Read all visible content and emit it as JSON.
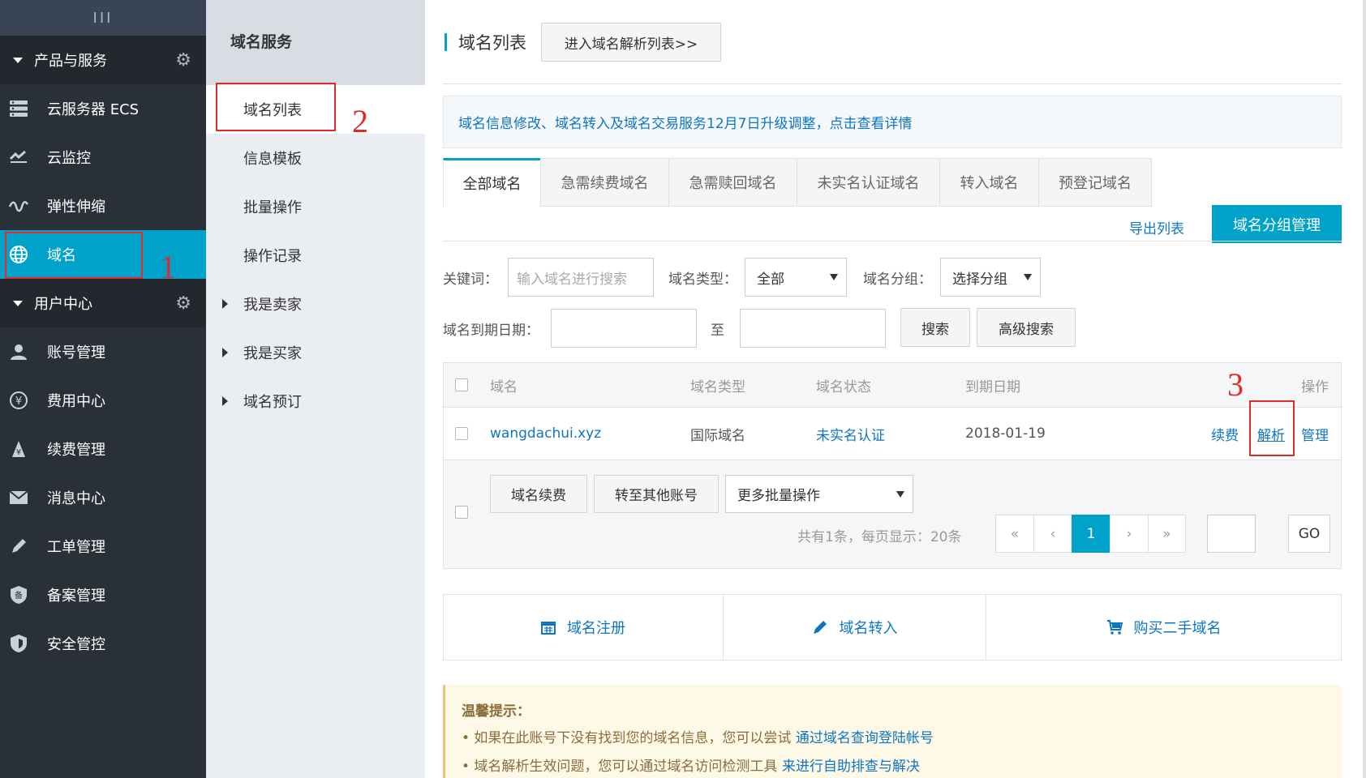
{
  "sidebar": {
    "toggle": "III",
    "groups": [
      {
        "title": "产品与服务",
        "items": [
          {
            "label": "云服务器 ECS",
            "icon": "server-icon"
          },
          {
            "label": "云监控",
            "icon": "monitor-icon"
          },
          {
            "label": "弹性伸缩",
            "icon": "scaling-icon"
          },
          {
            "label": "域名",
            "icon": "globe-icon",
            "active": true
          }
        ]
      },
      {
        "title": "用户中心",
        "items": [
          {
            "label": "账号管理",
            "icon": "user-icon"
          },
          {
            "label": "费用中心",
            "icon": "yen-icon"
          },
          {
            "label": "续费管理",
            "icon": "renew-icon"
          },
          {
            "label": "消息中心",
            "icon": "mail-icon"
          },
          {
            "label": "工单管理",
            "icon": "pencil-icon"
          },
          {
            "label": "备案管理",
            "icon": "record-icon"
          },
          {
            "label": "安全管控",
            "icon": "shield-icon"
          }
        ]
      }
    ]
  },
  "subnav": {
    "title": "域名服务",
    "items": [
      {
        "label": "域名列表",
        "active": true
      },
      {
        "label": "信息模板"
      },
      {
        "label": "批量操作"
      },
      {
        "label": "操作记录"
      },
      {
        "label": "我是卖家",
        "expandable": true
      },
      {
        "label": "我是买家",
        "expandable": true
      },
      {
        "label": "域名预订",
        "expandable": true
      }
    ]
  },
  "annotations": [
    "1",
    "2",
    "3"
  ],
  "header": {
    "title": "域名列表",
    "goto_button": "进入域名解析列表>>"
  },
  "notice": "域名信息修改、域名转入及域名交易服务12月7日升级调整，点击查看详情",
  "tabs": [
    "全部域名",
    "急需续费域名",
    "急需赎回域名",
    "未实名认证域名",
    "转入域名",
    "预登记域名"
  ],
  "toolbar": {
    "export": "导出列表",
    "group_manage": "域名分组管理"
  },
  "filters": {
    "keyword_label": "关键词：",
    "keyword_placeholder": "输入域名进行搜索",
    "type_label": "域名类型：",
    "type_value": "全部",
    "group_label": "域名分组：",
    "group_value": "选择分组",
    "expire_label": "域名到期日期：",
    "to": "至",
    "search": "搜索",
    "advanced": "高级搜索"
  },
  "table": {
    "columns": [
      "域名",
      "域名类型",
      "域名状态",
      "到期日期",
      "操作"
    ],
    "rows": [
      {
        "domain": "wangdachui.xyz",
        "type": "国际域名",
        "status": "未实名认证",
        "expire": "2018-01-19",
        "actions": [
          "续费",
          "解析",
          "管理"
        ]
      }
    ]
  },
  "batch": {
    "renew": "域名续费",
    "transfer": "转至其他账号",
    "more": "更多批量操作",
    "summary": "共有1条，每页显示：20条",
    "pages": [
      "«",
      "‹",
      "1",
      "›",
      "»"
    ],
    "current_page": "1",
    "go": "GO"
  },
  "actions": [
    {
      "label": "域名注册",
      "icon": "calendar-icon"
    },
    {
      "label": "域名转入",
      "icon": "pencil-icon"
    },
    {
      "label": "购买二手域名",
      "icon": "cart-icon"
    }
  ],
  "tips": {
    "title": "温馨提示：",
    "line1_text": "• 如果在此账号下没有找到您的域名信息，您可以尝试",
    "line1_link": "通过域名查询登陆帐号",
    "line2_text": "• 域名解析生效问题，您可以通过域名访问检测工具",
    "line2_link": "来进行自助排查与解决"
  },
  "colors": {
    "accent": "#00a2ca",
    "sidebar_bg": "#293038",
    "link": "#0e76c1",
    "annotation_red": "#e02b2b"
  }
}
